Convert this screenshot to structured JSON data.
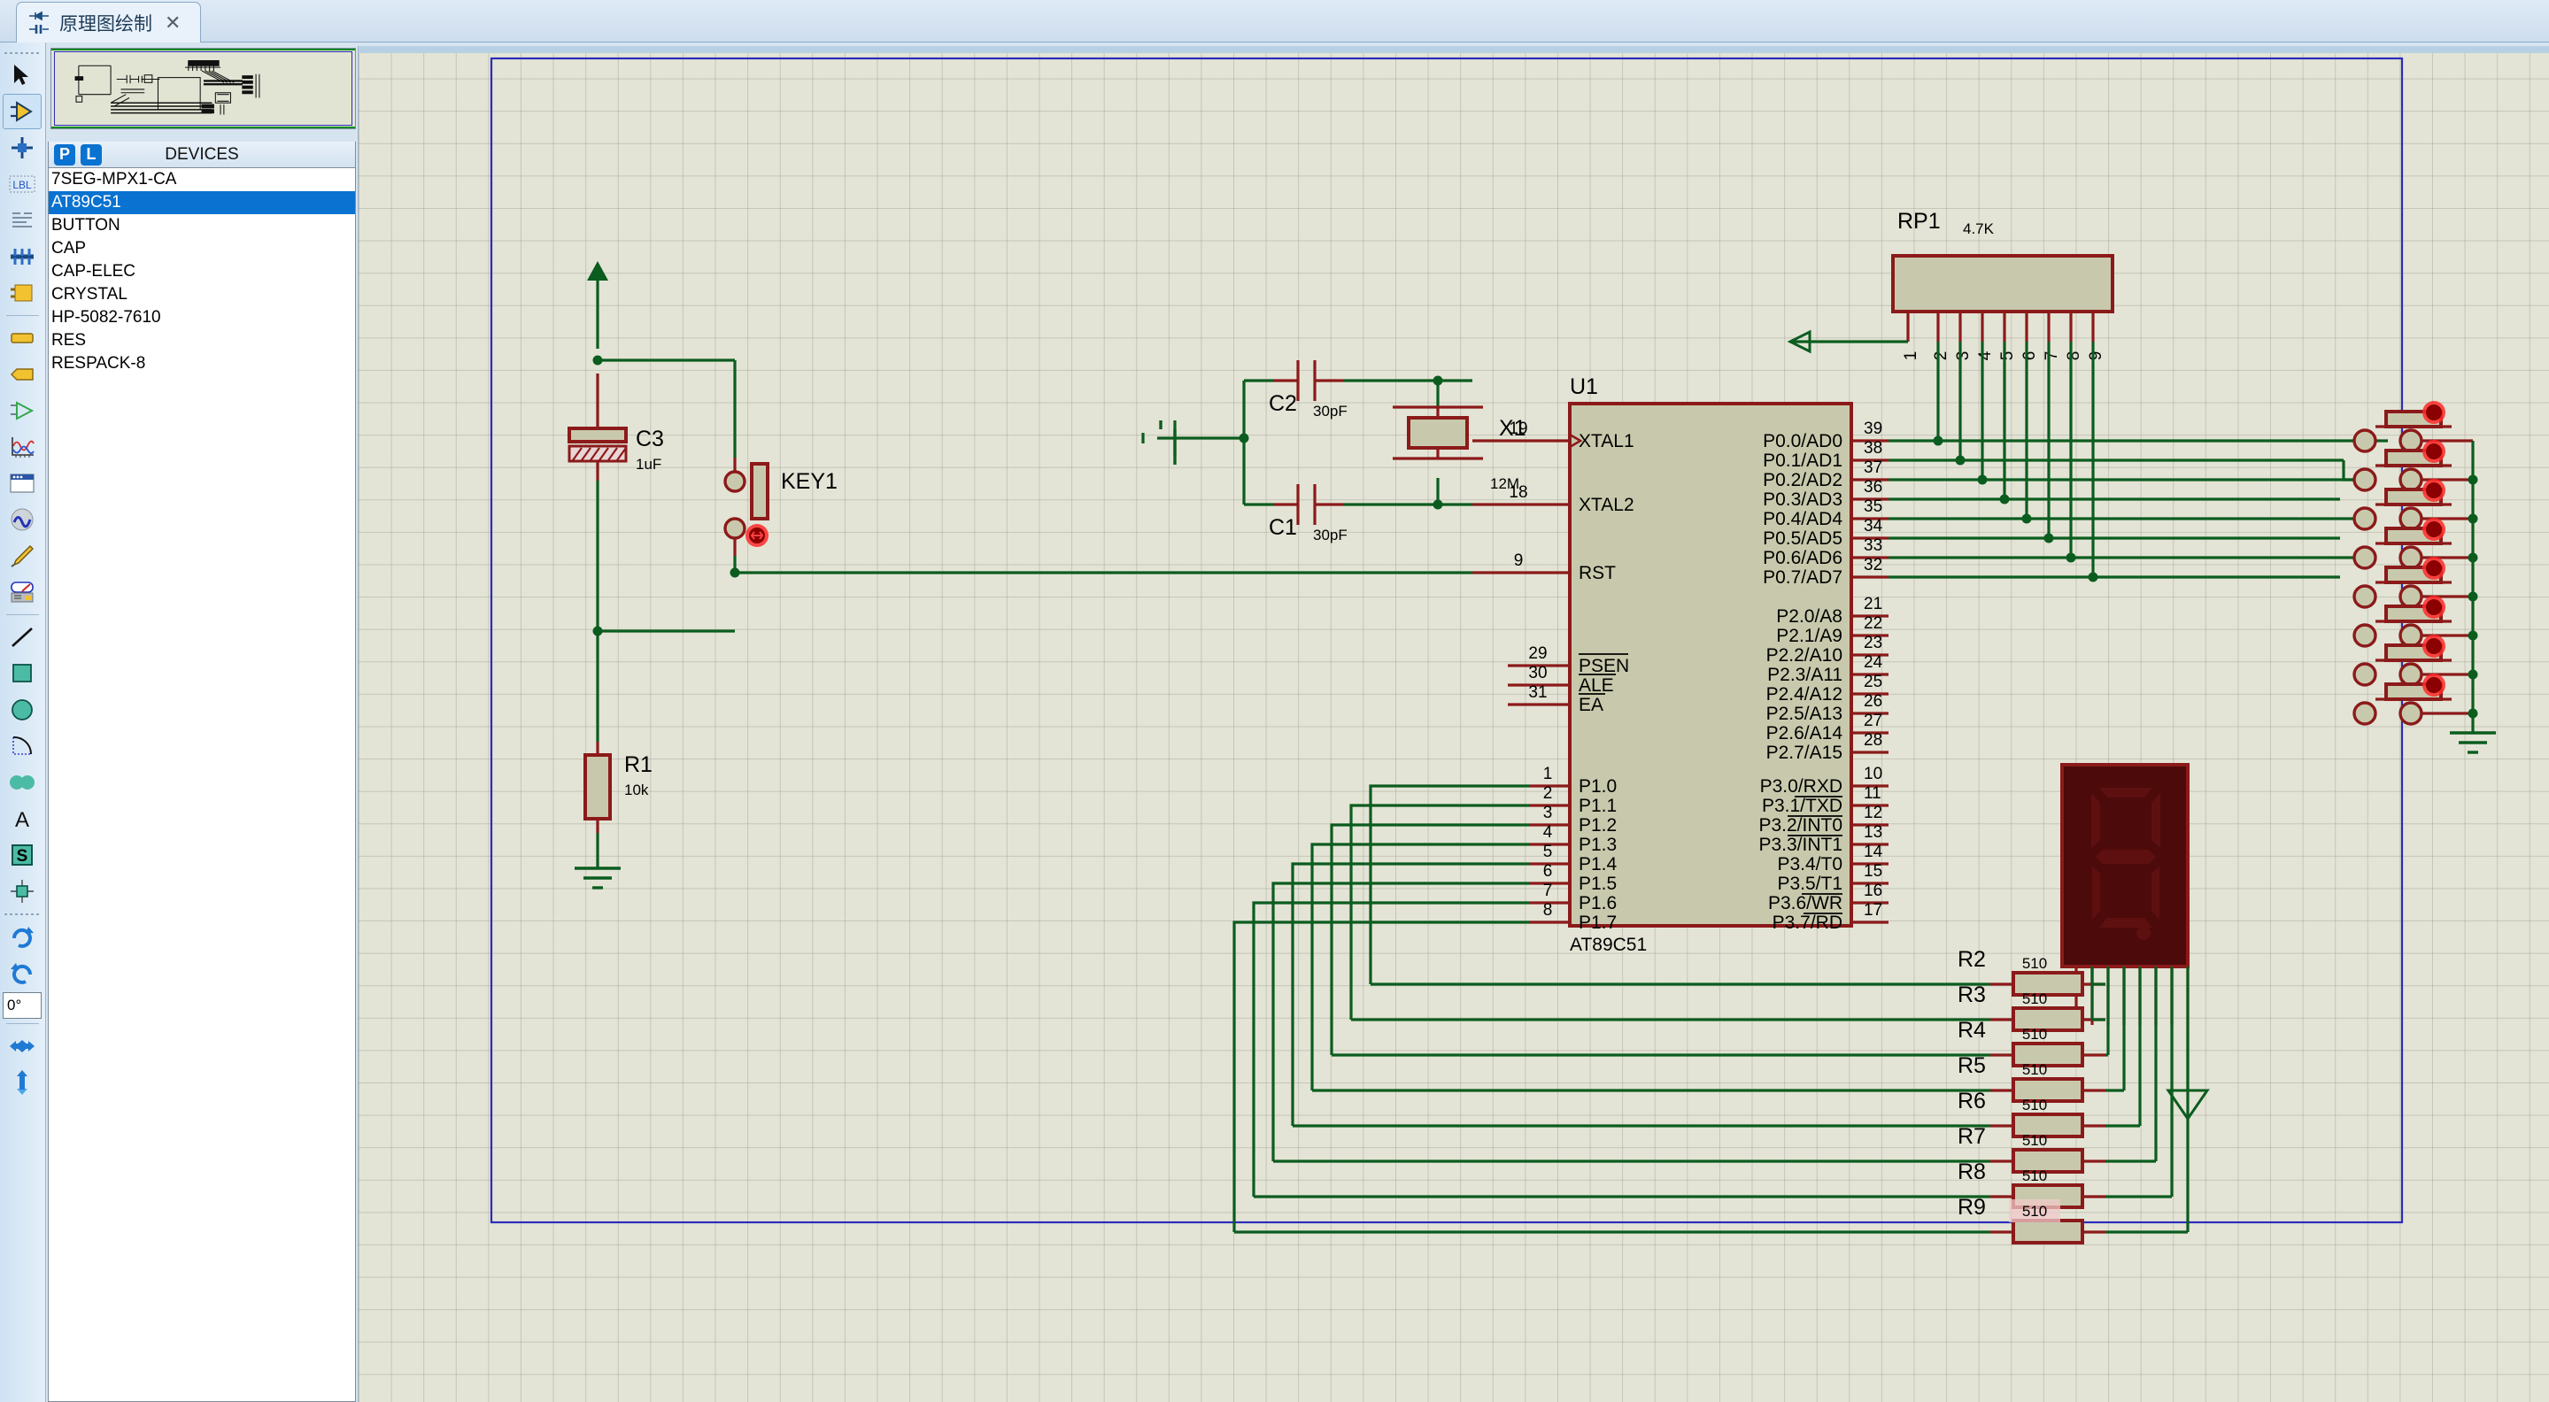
{
  "app": {
    "tab_label": "原理图绘制",
    "tab_icon": "schematic-icon",
    "close_label": "✕"
  },
  "toolbar": {
    "items": [
      {
        "name": "selection-mode",
        "label": "Selection Mode",
        "icon": "arrow-cursor-icon",
        "selected": false
      },
      {
        "name": "component-mode",
        "label": "Component Mode",
        "icon": "component-arrow-icon",
        "selected": true
      },
      {
        "name": "junction-dot-mode",
        "label": "Junction Dot Mode",
        "icon": "junction-cross-icon",
        "selected": false
      },
      {
        "name": "wire-label-mode",
        "label": "Wire Label Mode",
        "icon": "lbl-icon",
        "selected": false
      },
      {
        "name": "text-script-mode",
        "label": "Text Script Mode",
        "icon": "text-lines-icon",
        "selected": false
      },
      {
        "name": "buses-mode",
        "label": "Buses Mode",
        "icon": "bus-icon",
        "selected": false
      },
      {
        "name": "subcircuit-mode",
        "label": "Subcircuit Mode",
        "icon": "subcircuit-icon",
        "selected": false
      },
      {
        "name": "terminals-mode",
        "label": "Terminals Mode",
        "icon": "terminal-icon",
        "selected": false
      },
      {
        "name": "device-pins-mode",
        "label": "Device Pins Mode",
        "icon": "pin-arrow-icon",
        "selected": false
      },
      {
        "name": "graph-mode",
        "label": "Graph Mode",
        "icon": "graph-wave-icon",
        "selected": false
      },
      {
        "name": "tape-recorder-mode",
        "label": "Tape Recorder Mode",
        "icon": "window-icon",
        "selected": false
      },
      {
        "name": "generator-mode",
        "label": "Generator Mode",
        "icon": "sine-circle-icon",
        "selected": false
      },
      {
        "name": "voltage-probe-mode",
        "label": "Voltage Probe Mode",
        "icon": "probe-pen-icon",
        "selected": false
      },
      {
        "name": "virtual-instruments-mode",
        "label": "Virtual Instruments Mode",
        "icon": "meter-icon",
        "selected": false
      },
      {
        "name": "line-tool",
        "label": "2D Graphics Line Mode",
        "icon": "line-icon",
        "selected": false
      },
      {
        "name": "box-tool",
        "label": "2D Graphics Box Mode",
        "icon": "square-icon",
        "selected": false
      },
      {
        "name": "circle-tool",
        "label": "2D Graphics Circle Mode",
        "icon": "circle-icon",
        "selected": false
      },
      {
        "name": "arc-tool",
        "label": "2D Graphics Arc Mode",
        "icon": "arc-icon",
        "selected": false
      },
      {
        "name": "path-tool",
        "label": "2D Graphics Closed Path Mode",
        "icon": "path-blob-icon",
        "selected": false
      },
      {
        "name": "text-tool",
        "label": "2D Graphics Text Mode",
        "icon": "letter-a-icon",
        "selected": false
      },
      {
        "name": "symbol-tool",
        "label": "2D Graphics Symbols Mode",
        "icon": "symbol-s-icon",
        "selected": false
      },
      {
        "name": "marker-tool",
        "label": "2D Graphics Markers Mode",
        "icon": "origin-marker-icon",
        "selected": false
      }
    ],
    "rotate_cw": {
      "name": "rotate-clockwise-button",
      "label": "Rotate Clockwise",
      "icon": "rotate-cw-icon"
    },
    "rotate_ccw": {
      "name": "rotate-anticlockwise-button",
      "label": "Rotate Anti-Clockwise",
      "icon": "rotate-ccw-icon"
    },
    "rotation_value": "0°",
    "mirror_x": {
      "name": "mirror-horizontal-button",
      "label": "X-Mirror",
      "icon": "mirror-horizontal-icon"
    },
    "mirror_y": {
      "name": "mirror-vertical-button",
      "label": "Y-Mirror",
      "icon": "mirror-vertical-icon"
    }
  },
  "devices_panel": {
    "title": "DEVICES",
    "pick_button": "P",
    "library_button": "L",
    "items": [
      {
        "label": "7SEG-MPX1-CA",
        "selected": false
      },
      {
        "label": "AT89C51",
        "selected": true
      },
      {
        "label": "BUTTON",
        "selected": false
      },
      {
        "label": "CAP",
        "selected": false
      },
      {
        "label": "CAP-ELEC",
        "selected": false
      },
      {
        "label": "CRYSTAL",
        "selected": false
      },
      {
        "label": "HP-5082-7610",
        "selected": false
      },
      {
        "label": "RES",
        "selected": false
      },
      {
        "label": "RESPACK-8",
        "selected": false
      }
    ]
  },
  "colors": {
    "canvas_bg": "#e3e4d5",
    "wire_green": "#0b5c1f",
    "component_red": "#8b1a1a",
    "component_fill": "#c8c9ac",
    "text_black": "#000000",
    "sheet_border_blue": "#2b2bbb",
    "led_display_bg": "#4d0a0a",
    "selected_blue": "#0a72d0"
  },
  "schematic": {
    "mcu": {
      "ref": "U1",
      "part": "AT89C51",
      "left_pins": [
        {
          "num": "19",
          "label": "XTAL1"
        },
        {
          "num": "18",
          "label": "XTAL2"
        },
        {
          "num": "9",
          "label": "RST"
        },
        {
          "num": "29",
          "label": "PSEN",
          "overbar": true
        },
        {
          "num": "30",
          "label": "ALE",
          "overbar": true
        },
        {
          "num": "31",
          "label": "EA",
          "overbar": true
        },
        {
          "num": "1",
          "label": "P1.0"
        },
        {
          "num": "2",
          "label": "P1.1"
        },
        {
          "num": "3",
          "label": "P1.2"
        },
        {
          "num": "4",
          "label": "P1.3"
        },
        {
          "num": "5",
          "label": "P1.4"
        },
        {
          "num": "6",
          "label": "P1.5"
        },
        {
          "num": "7",
          "label": "P1.6"
        },
        {
          "num": "8",
          "label": "P1.7"
        }
      ],
      "right_pins": [
        {
          "num": "39",
          "label": "P0.0/AD0"
        },
        {
          "num": "38",
          "label": "P0.1/AD1"
        },
        {
          "num": "37",
          "label": "P0.2/AD2"
        },
        {
          "num": "36",
          "label": "P0.3/AD3"
        },
        {
          "num": "35",
          "label": "P0.4/AD4"
        },
        {
          "num": "34",
          "label": "P0.5/AD5"
        },
        {
          "num": "33",
          "label": "P0.6/AD6"
        },
        {
          "num": "32",
          "label": "P0.7/AD7"
        },
        {
          "num": "21",
          "label": "P2.0/A8"
        },
        {
          "num": "22",
          "label": "P2.1/A9"
        },
        {
          "num": "23",
          "label": "P2.2/A10"
        },
        {
          "num": "24",
          "label": "P2.3/A11"
        },
        {
          "num": "25",
          "label": "P2.4/A12"
        },
        {
          "num": "26",
          "label": "P2.5/A13"
        },
        {
          "num": "27",
          "label": "P2.6/A14"
        },
        {
          "num": "28",
          "label": "P2.7/A15"
        },
        {
          "num": "10",
          "label": "P3.0/RXD"
        },
        {
          "num": "11",
          "label": "P3.1/TXD"
        },
        {
          "num": "12",
          "label": "P3.2/INT0"
        },
        {
          "num": "13",
          "label": "P3.3/INT1"
        },
        {
          "num": "14",
          "label": "P3.4/T0"
        },
        {
          "num": "15",
          "label": "P3.5/T1"
        },
        {
          "num": "16",
          "label": "P3.6/WR"
        },
        {
          "num": "17",
          "label": "P3.7/RD"
        }
      ]
    },
    "components": [
      {
        "ref": "C3",
        "value": "1uF",
        "type": "cap-elec"
      },
      {
        "ref": "R1",
        "value": "10k",
        "type": "res"
      },
      {
        "ref": "KEY1",
        "value": "",
        "type": "button"
      },
      {
        "ref": "C2",
        "value": "30pF",
        "type": "cap"
      },
      {
        "ref": "C1",
        "value": "30pF",
        "type": "cap"
      },
      {
        "ref": "X1",
        "value": "12M",
        "type": "crystal"
      },
      {
        "ref": "RP1",
        "value": "4.7K",
        "type": "respack-8"
      },
      {
        "ref": "R2",
        "value": "510",
        "type": "res"
      },
      {
        "ref": "R3",
        "value": "510",
        "type": "res"
      },
      {
        "ref": "R4",
        "value": "510",
        "type": "res"
      },
      {
        "ref": "R5",
        "value": "510",
        "type": "res"
      },
      {
        "ref": "R6",
        "value": "510",
        "type": "res"
      },
      {
        "ref": "R7",
        "value": "510",
        "type": "res"
      },
      {
        "ref": "R8",
        "value": "510",
        "type": "res"
      },
      {
        "ref": "R9",
        "value": "510",
        "type": "res",
        "value_highlighted": true
      }
    ],
    "respack_pins": [
      "1",
      "2",
      "3",
      "4",
      "5",
      "6",
      "7",
      "8",
      "9"
    ],
    "display": {
      "type": "7SEG-MPX1-CA",
      "pin_count": 9
    },
    "button_count": 8
  }
}
